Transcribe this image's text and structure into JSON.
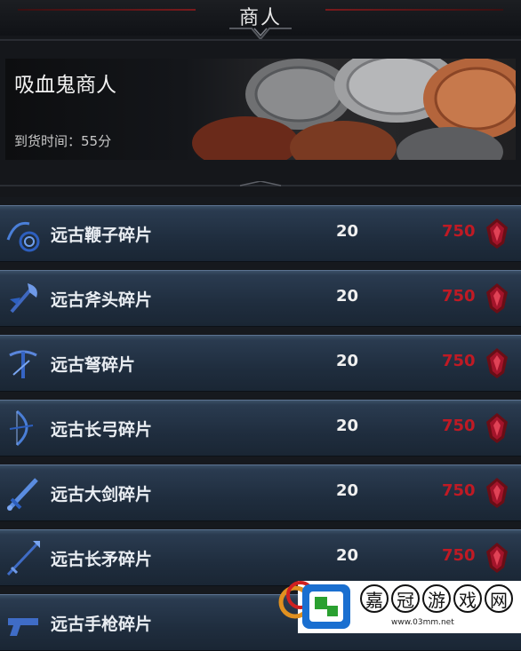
{
  "header": {
    "title": "商人"
  },
  "vendor": {
    "name": "吸血鬼商人",
    "arrival_label": "到货时间：55分"
  },
  "items": [
    {
      "name": "远古鞭子碎片",
      "qty": "20",
      "price": "750",
      "icon": "whip-icon"
    },
    {
      "name": "远古斧头碎片",
      "qty": "20",
      "price": "750",
      "icon": "axe-icon"
    },
    {
      "name": "远古弩碎片",
      "qty": "20",
      "price": "750",
      "icon": "crossbow-icon"
    },
    {
      "name": "远古长弓碎片",
      "qty": "20",
      "price": "750",
      "icon": "longbow-icon"
    },
    {
      "name": "远古大剑碎片",
      "qty": "20",
      "price": "750",
      "icon": "greatsword-icon"
    },
    {
      "name": "远古长矛碎片",
      "qty": "20",
      "price": "750",
      "icon": "spear-icon"
    },
    {
      "name": "远古手枪碎片",
      "qty": "",
      "price": "",
      "icon": "pistol-icon"
    }
  ],
  "watermark": {
    "chars": [
      "嘉",
      "冠",
      "游",
      "戏",
      "网"
    ],
    "url": "www.03mm.net"
  },
  "colors": {
    "price": "#c01a24",
    "row_top": "#3a4f66",
    "row_bottom": "#1a2634"
  }
}
